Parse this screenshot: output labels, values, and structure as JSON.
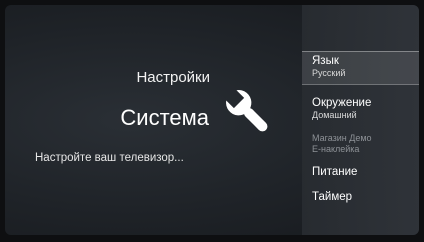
{
  "header": {
    "section": "Настройки",
    "title": "Система",
    "description": "Настройте ваш телевизор..."
  },
  "icon": {
    "main": "wrench-icon"
  },
  "menu": {
    "items": [
      {
        "label": "Язык",
        "value": "Русский",
        "state": "focused"
      },
      {
        "label": "Окружение",
        "value": "Домашний",
        "state": "normal"
      },
      {
        "label": "Магазин Демо",
        "value": "E-наклейка",
        "state": "disabled"
      },
      {
        "label": "Питание",
        "state": "normal"
      },
      {
        "label": "Таймер",
        "state": "normal"
      }
    ]
  },
  "colors": {
    "background": "#1f2328",
    "menu_background": "#2d3137",
    "text": "#ffffff",
    "disabled_text": "#8d9196"
  }
}
